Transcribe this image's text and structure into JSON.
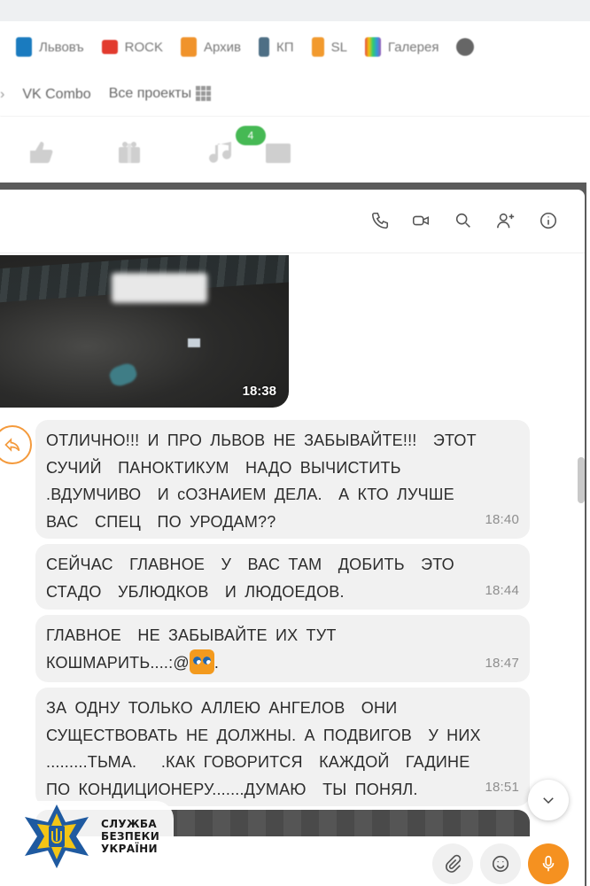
{
  "browser": {
    "bookmarks": [
      {
        "label": "Львовъ",
        "color": "#1a7bbf"
      },
      {
        "label": "ROCK",
        "color": "#e23b2e"
      },
      {
        "label": "Архив",
        "color": "#f0932b"
      },
      {
        "label": "КП",
        "color": "#4e6f85"
      },
      {
        "label": "SL",
        "color": "#f29a2e"
      },
      {
        "label": "Галерея",
        "color": "#7b5ea8"
      }
    ],
    "bookmarks_row2": [
      "VK Combo",
      "Все проекты"
    ]
  },
  "site_nav": {
    "badge_count": "4"
  },
  "chat": {
    "header_icons": [
      "phone-icon",
      "video-call-icon",
      "search-icon",
      "add-user-icon",
      "info-icon"
    ],
    "photo_time": "18:38",
    "messages": [
      {
        "text": "ОТЛИЧНО!!! И ПРО ЛЬВОВ НЕ ЗАБЫВАЙТЕ!!!  ЭТОТ\nСУЧИЙ  ПАНОКТИКУМ  НАДО ВЫЧИСТИТЬ\n.ВДУМЧИВО  И сОЗНАИЕМ ДЕЛА.  А КТО ЛУЧШЕ\nВАС  СПЕЦ  ПО УРОДАМ??",
        "time": "18:40"
      },
      {
        "text": "СЕЙЧАС  ГЛАВНОЕ  У  ВАС ТАМ  ДОБИТЬ  ЭТО\nСТАДО  УБЛЮДКОВ  И ЛЮДОЕДОВ.",
        "time": "18:44"
      },
      {
        "text_before_emoji": "ГЛАВНОЕ  НЕ ЗАБЫВАЙТЕ ИХ ТУТ\nКОШМАРИТЬ....:@",
        "text_after_emoji": ".",
        "time": "18:47"
      },
      {
        "text": "ЗА ОДНУ ТОЛЬКО АЛЛЕЮ АНГЕЛОВ  ОНИ\nСУЩЕСТВОВАТЬ НЕ ДОЛЖНЫ. А ПОДВИГОВ  У НИХ\n.........ТЬМА.   .КАК ГОВОРИТСЯ  КАЖДОЙ  ГАДИНЕ\nПО КОНДИЦИОНЕРУ.......ДУМАЮ  ТЫ ПОНЯЛ.",
        "time": "18:51"
      }
    ]
  },
  "watermark": {
    "lines": [
      "СЛУЖБА",
      "БЕЗПЕКИ",
      "УКРАЇНИ"
    ]
  },
  "input_bar": {
    "icons": [
      "paperclip-icon",
      "emoji-icon",
      "microphone-icon"
    ],
    "accent_color": "#f59120"
  },
  "colors": {
    "accent": "#f59120",
    "bubble": "#f1f1f1",
    "badge": "#46b954"
  }
}
